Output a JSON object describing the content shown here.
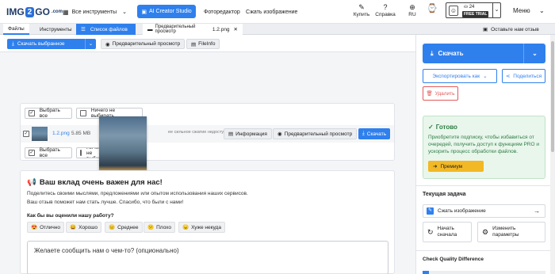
{
  "header": {
    "logo_prefix": "IMG",
    "logo_mid": "2",
    "logo_suffix": "GO",
    "logo_tld": ".com",
    "all_tools": "Все инструменты",
    "ai_studio": "AI Creator Studio",
    "photo_editor": "Фоторедактор",
    "compress_image": "Сжать изображение",
    "buy": "Купить",
    "help": "Справка",
    "lang": "RU",
    "credits": "24",
    "tier": "FREE TRIAL",
    "menu": "Меню"
  },
  "tabs": {
    "files": "Файлы",
    "tools": "Инструменты",
    "file_list": "Список файлов",
    "preview_tab": "Предварительный просмотр",
    "preview_file": "1.2.png",
    "feedback": "Оставьте нам отзыв"
  },
  "toolbar": {
    "download_selected": "Скачать выбранное",
    "preview": "Предварительный просмотр",
    "fileinfo": "FileInfo"
  },
  "filelist": {
    "select_all": "Выбрать все",
    "select_none": "Ничего не выбирать",
    "file_name": "1.2.png",
    "file_size": "5.85 MB",
    "compress_note": "ее сильное сжатие недоступно",
    "info": "Информация",
    "preview": "Предварительный просмотр",
    "download": "Скачать",
    "select_none_bottom": "Ничего не выбирать"
  },
  "feedback": {
    "title": "Ваш вклад очень важен для нас!",
    "line1": "Поделитесь своими мыслями, предложениями или опытом использования наших сервисов.",
    "line2": "Ваш отзыв поможет нам стать лучше. Спасибо, что были с нами!",
    "question": "Как бы вы оценили нашу работу?",
    "ratings": [
      "Отлично",
      "Хорошо",
      "Среднее",
      "Плохо",
      "Хуже некуда"
    ],
    "placeholder": "Желаете сообщить нам о чем-то? (опционально)"
  },
  "right": {
    "download": "Скачать",
    "export_as": "Экспортировать как",
    "share": "Поделиться",
    "delete": "Удалить",
    "ready_title": "Готово",
    "ready_text": "Приобретите подписку, чтобы избавиться от очередей, получить доступ к функциям PRO и ускорить процесс обработки файлов.",
    "premium": "Премиум",
    "current_task": "Текущая задача",
    "task_compress": "Сжать изображение",
    "start_over_1": "Начать",
    "start_over_2": "сначала",
    "change_params_1": "Изменить",
    "change_params_2": "параметры",
    "quality_diff": "Check Quality Difference"
  },
  "colors": {
    "accent": "#2f80ed",
    "success": "#2e7d43",
    "danger": "#e25a5a",
    "premium": "#f2b825"
  }
}
